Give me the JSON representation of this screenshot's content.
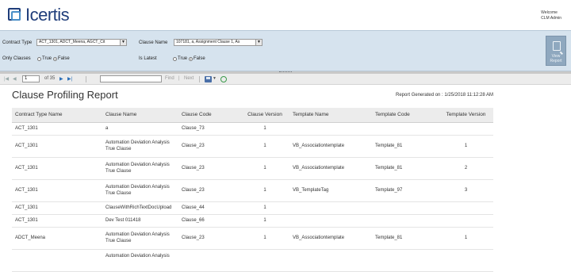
{
  "header": {
    "logo_text": "Icertis",
    "welcome_label": "Welcome",
    "user_name": "CLM Admin"
  },
  "params": {
    "contract_type_label": "Contract Type",
    "contract_type_value": "ACT_1301, ADCT_Meena, AGCT_Cit",
    "clause_name_label": "Clause Name",
    "clause_name_value": "107181, a, Assignment Clause 1, As",
    "only_clauses_label": "Only Clauses",
    "is_latest_label": "Is Latest",
    "true_label": "True",
    "false_label": "False",
    "view_report_label": "View Report",
    "only_clauses_selected": "False",
    "is_latest_selected": "False"
  },
  "toolbar": {
    "first_icon": "first-page-icon",
    "prev_icon": "prev-page-icon",
    "page_value": "1",
    "page_of": "of 35",
    "next_icon": "next-page-icon",
    "last_icon": "last-page-icon",
    "find_label": "Find",
    "next_label": "Next",
    "separator": "|"
  },
  "report": {
    "title": "Clause Profiling Report",
    "generated": "Report Generated on : 1/25/2018 11:12:28 AM",
    "columns": [
      "Contract Type Name",
      "Clause Name",
      "Clause Code",
      "Clause Version",
      "Template Name",
      "Template Code",
      "Template Version"
    ],
    "rows": [
      {
        "contract": "ACT_1301",
        "clause_name": "a",
        "clause_code": "Clause_73",
        "clause_version": "1",
        "template_name": "",
        "template_code": "",
        "template_version": ""
      },
      {
        "contract": "ACT_1301",
        "clause_name": "Automation Deviation Analysis True Clause",
        "clause_code": "Clause_23",
        "clause_version": "1",
        "template_name": "VB_Associationtemplate",
        "template_code": "Template_81",
        "template_version": "1"
      },
      {
        "contract": "ACT_1301",
        "clause_name": "Automation Deviation Analysis True Clause",
        "clause_code": "Clause_23",
        "clause_version": "1",
        "template_name": "VB_Associationtemplate",
        "template_code": "Template_81",
        "template_version": "2"
      },
      {
        "contract": "ACT_1301",
        "clause_name": "Automation Deviation Analysis True Clause",
        "clause_code": "Clause_23",
        "clause_version": "1",
        "template_name": "VB_TemplateTag",
        "template_code": "Template_97",
        "template_version": "3"
      },
      {
        "contract": "ACT_1301",
        "clause_name": "ClauseWithRichTextDocUpload",
        "clause_code": "Clause_44",
        "clause_version": "1",
        "template_name": "",
        "template_code": "",
        "template_version": ""
      },
      {
        "contract": "ACT_1301",
        "clause_name": "Dev Test 011418",
        "clause_code": "Clause_66",
        "clause_version": "1",
        "template_name": "",
        "template_code": "",
        "template_version": ""
      },
      {
        "contract": "ADCT_Meena",
        "clause_name": "Automation Deviation Analysis True Clause",
        "clause_code": "Clause_23",
        "clause_version": "1",
        "template_name": "VB_Associationtemplate",
        "template_code": "Template_81",
        "template_version": "1"
      },
      {
        "contract": "",
        "clause_name": "Automation Deviation Analysis",
        "clause_code": "",
        "clause_version": "",
        "template_name": "",
        "template_code": "",
        "template_version": ""
      }
    ]
  },
  "colors": {
    "param_bg": "#d6e3ee",
    "logo_blue": "#1f3d7a",
    "view_report_bg": "#8fa8bf",
    "header_row_bg": "#ececec"
  }
}
